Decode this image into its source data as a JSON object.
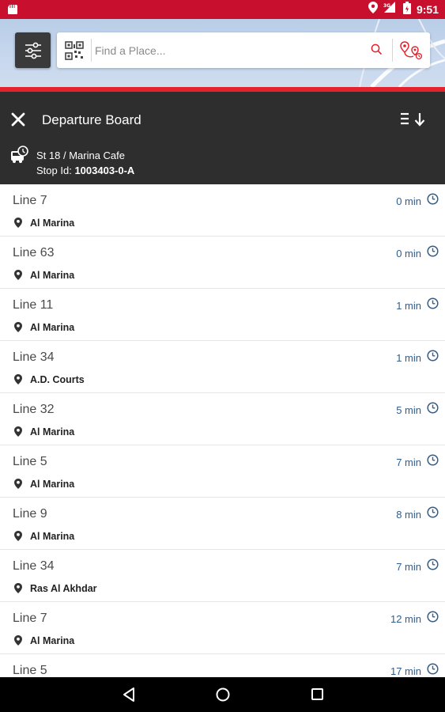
{
  "status_bar": {
    "time": "9:51",
    "network": "3G",
    "icons": [
      "notification-icon",
      "location-icon",
      "signal-icon",
      "battery-icon"
    ]
  },
  "search": {
    "placeholder": "Find a Place..."
  },
  "departure_board": {
    "title": "Departure Board",
    "stop_name": "St 18 / Marina Cafe",
    "stop_id_label": "Stop Id:",
    "stop_id_value": "1003403-0-A"
  },
  "departures": [
    {
      "line": "Line 7",
      "destination": "Al Marina",
      "time": "0 min"
    },
    {
      "line": "Line 63",
      "destination": "Al Marina",
      "time": "0 min"
    },
    {
      "line": "Line 11",
      "destination": "Al Marina",
      "time": "1 min"
    },
    {
      "line": "Line 34",
      "destination": "A.D. Courts",
      "time": "1 min"
    },
    {
      "line": "Line 32",
      "destination": "Al Marina",
      "time": "5 min"
    },
    {
      "line": "Line 5",
      "destination": "Al Marina",
      "time": "7 min"
    },
    {
      "line": "Line 9",
      "destination": "Al Marina",
      "time": "8 min"
    },
    {
      "line": "Line 34",
      "destination": "Ras Al Akhdar",
      "time": "7 min"
    },
    {
      "line": "Line 7",
      "destination": "Al Marina",
      "time": "12 min"
    },
    {
      "line": "Line 5",
      "destination": "",
      "time": "17 min"
    }
  ],
  "colors": {
    "status_bar": "#c8102e",
    "accent_red": "#e3222c",
    "header_dark": "#2e2e2e",
    "time_blue": "#2f5d8c"
  }
}
